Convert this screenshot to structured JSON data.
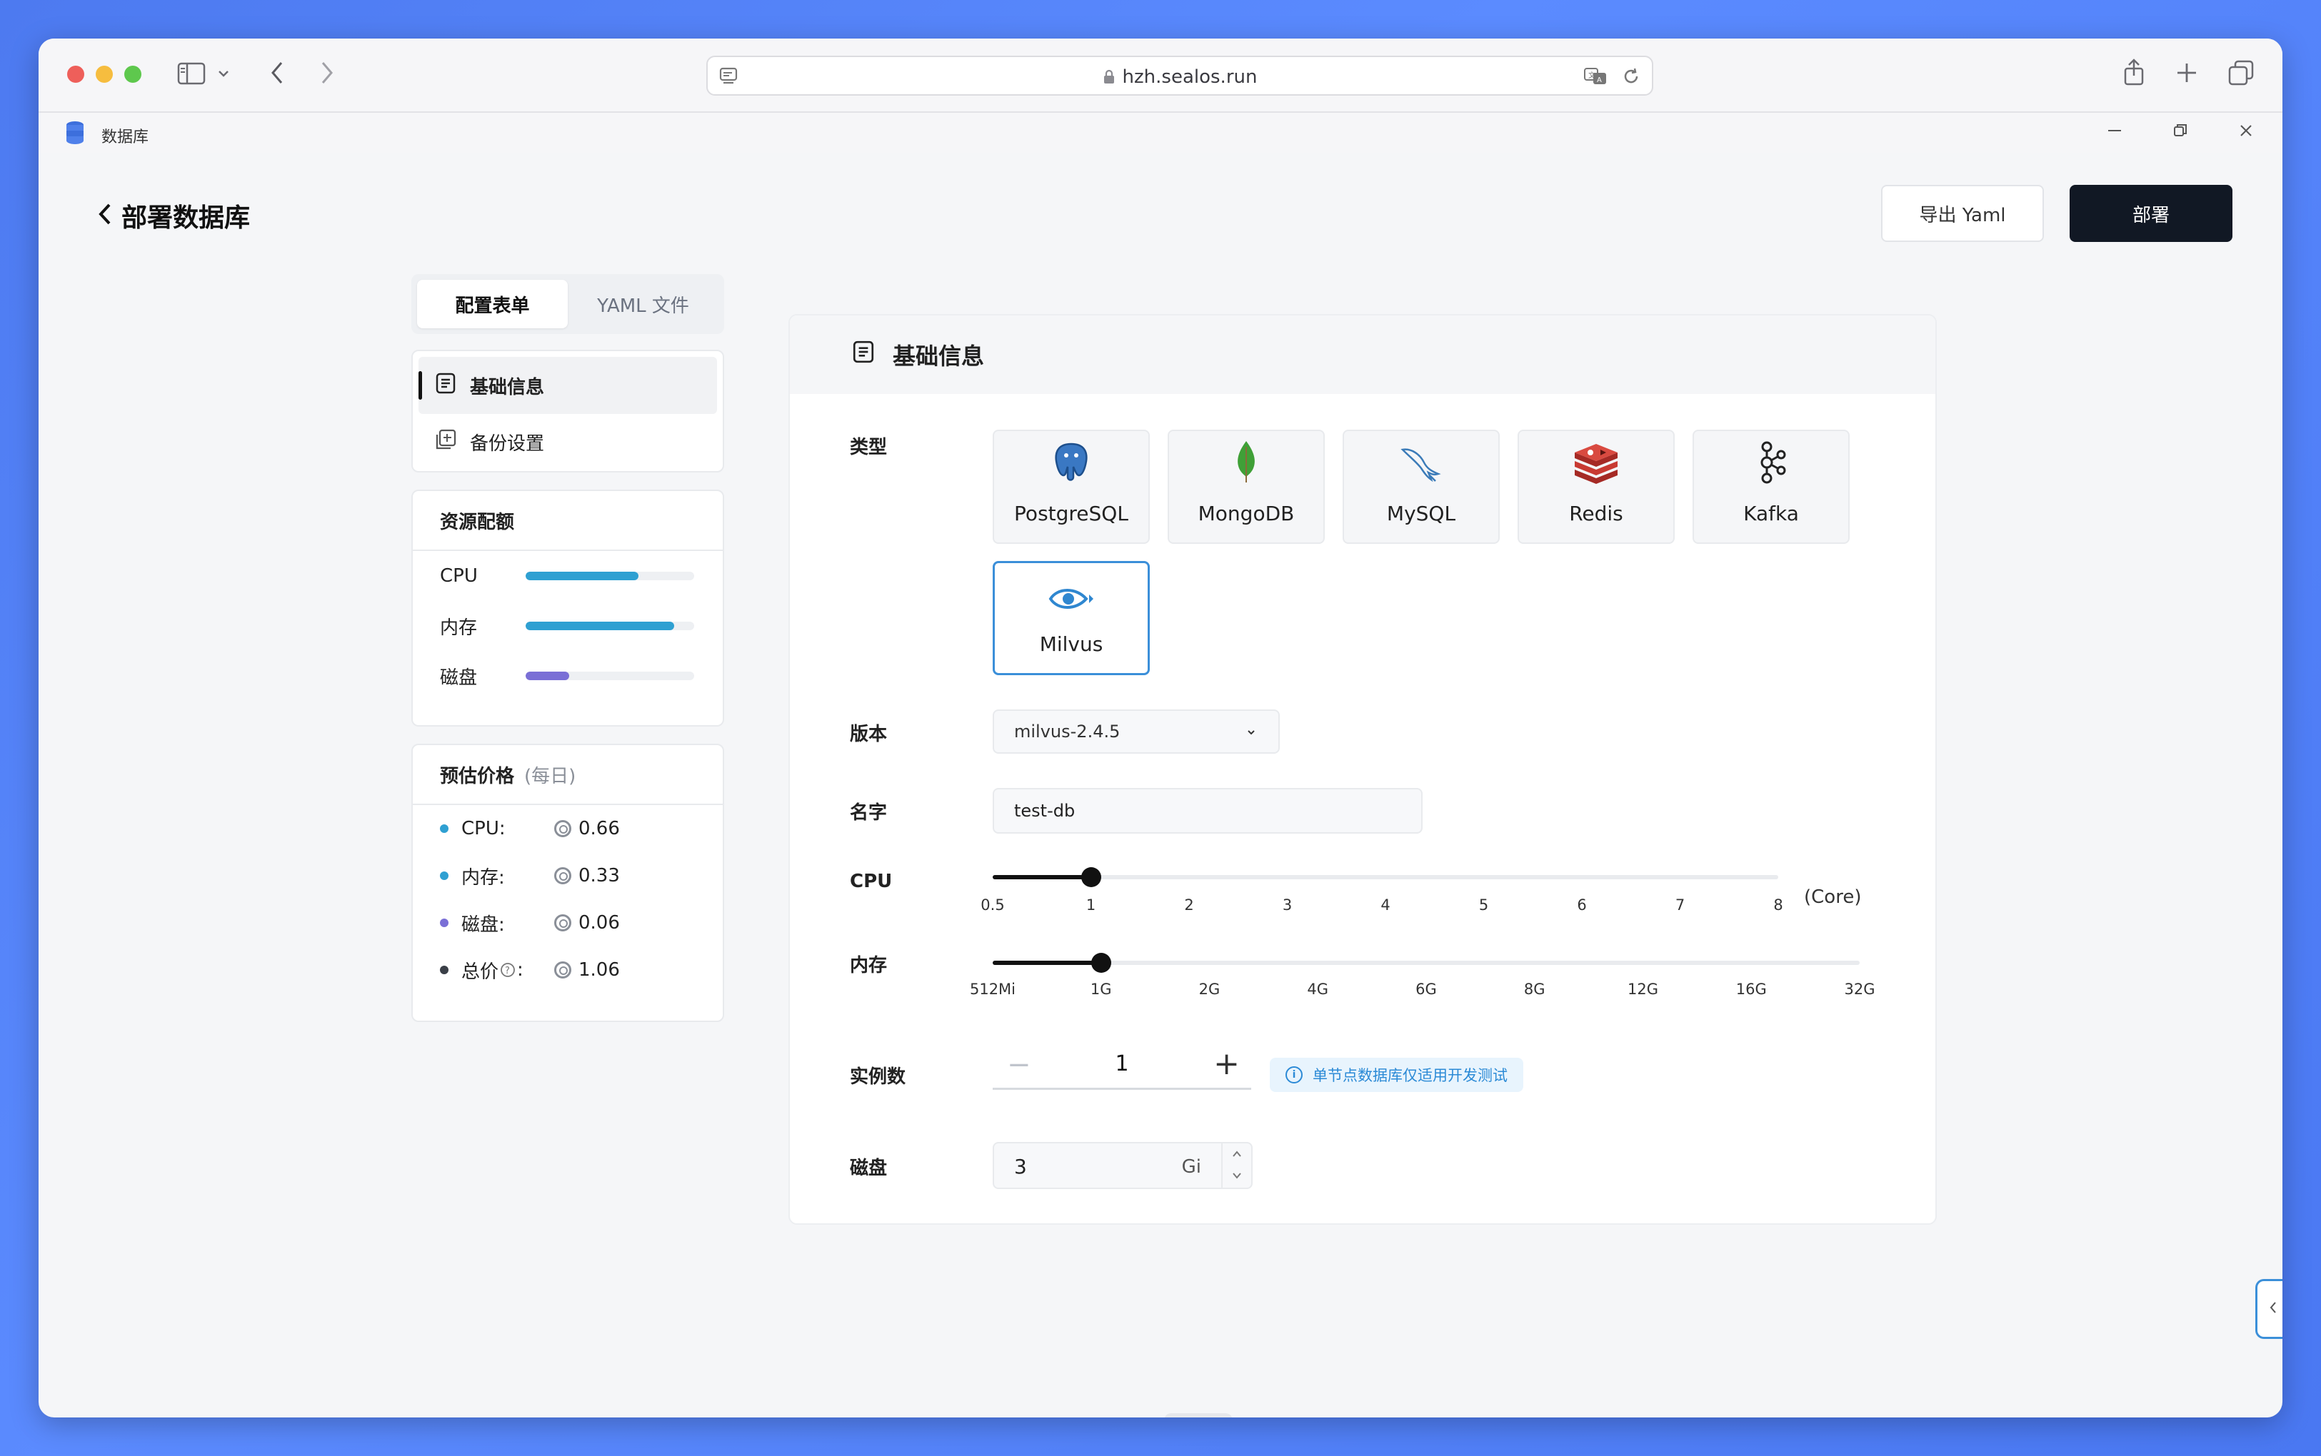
{
  "browser": {
    "url": "hzh.sealos.run"
  },
  "app": {
    "title": "数据库"
  },
  "page": {
    "title": "部署数据库",
    "export_label": "导出 Yaml",
    "deploy_label": "部署"
  },
  "tabs": [
    "配置表单",
    "YAML 文件"
  ],
  "nav": {
    "items": [
      "基础信息",
      "备份设置"
    ]
  },
  "quota": {
    "title": "资源配额",
    "rows": [
      {
        "label": "CPU",
        "fraction": 0.67,
        "color": "#2fa0d2"
      },
      {
        "label": "内存",
        "fraction": 0.88,
        "color": "#2fa0d2"
      },
      {
        "label": "磁盘",
        "fraction": 0.26,
        "color": "#7a6fd6"
      }
    ]
  },
  "price": {
    "title": "预估价格",
    "subtitle": "(每日)",
    "rows": [
      {
        "label": "CPU:",
        "value": "0.66",
        "color": "#2fa0d2"
      },
      {
        "label": "内存:",
        "value": "0.33",
        "color": "#2fa0d2"
      },
      {
        "label": "磁盘:",
        "value": "0.06",
        "color": "#7a6fd6"
      },
      {
        "label": "总价",
        "suffix": ":",
        "value": "1.06",
        "color": "#3a3f47"
      }
    ]
  },
  "form": {
    "section_title": "基础信息",
    "type_label": "类型",
    "db_types": [
      "PostgreSQL",
      "MongoDB",
      "MySQL",
      "Redis",
      "Kafka",
      "Milvus"
    ],
    "selected_type": "Milvus",
    "version_label": "版本",
    "version_value": "milvus-2.4.5",
    "name_label": "名字",
    "name_value": "test-db",
    "cpu_label": "CPU",
    "cpu_ticks": [
      "0.5",
      "1",
      "2",
      "3",
      "4",
      "5",
      "6",
      "7",
      "8"
    ],
    "cpu_selected_index": 1,
    "cpu_unit": "(Core)",
    "mem_label": "内存",
    "mem_ticks": [
      "512Mi",
      "1G",
      "2G",
      "4G",
      "6G",
      "8G",
      "12G",
      "16G",
      "32G"
    ],
    "mem_selected_index": 1,
    "replicas_label": "实例数",
    "replicas_value": "1",
    "replicas_tip": "单节点数据库仅适用开发测试",
    "disk_label": "磁盘",
    "disk_value": "3",
    "disk_unit": "Gi"
  }
}
